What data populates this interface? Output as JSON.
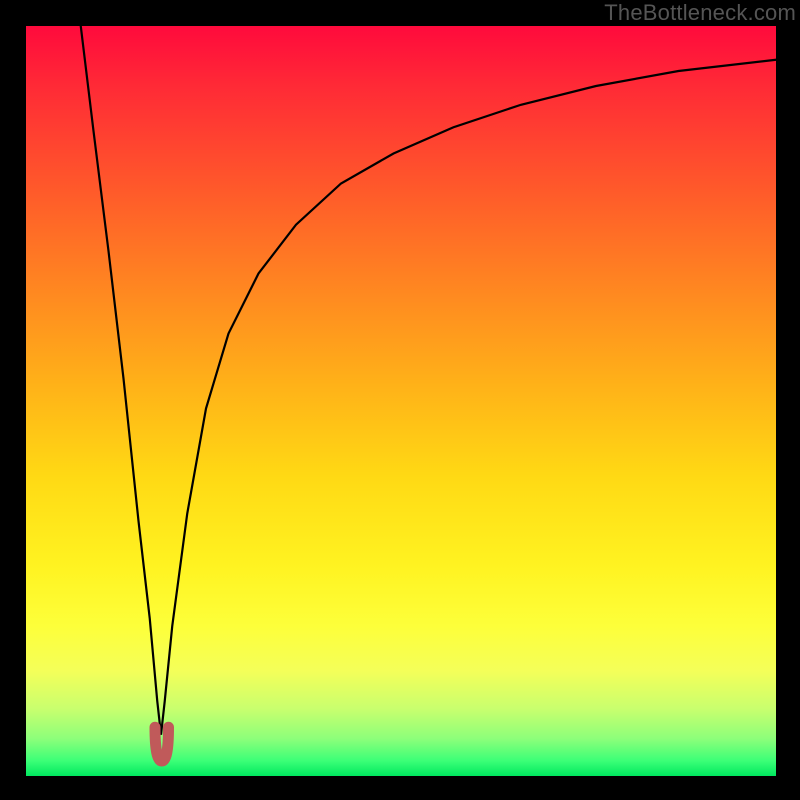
{
  "watermark": "TheBottleneck.com",
  "chart_data": {
    "type": "line",
    "title": "",
    "xlabel": "",
    "ylabel": "",
    "xlim": [
      0,
      100
    ],
    "ylim": [
      0,
      100
    ],
    "note": "No axes or tick labels are displayed. Background is a vertical red→yellow→green gradient (high→low). Curve shows a single sharp minimum near x≈18.",
    "series": [
      {
        "name": "curve",
        "color": "#000000",
        "x": [
          7.3,
          9,
          11,
          13,
          15,
          16.5,
          17.5,
          18.0,
          18.5,
          19.5,
          21.5,
          24,
          27,
          31,
          36,
          42,
          49,
          57,
          66,
          76,
          87,
          100
        ],
        "values": [
          100,
          86,
          70,
          53,
          34,
          21,
          10,
          5.5,
          10,
          20,
          35,
          49,
          59,
          67,
          73.5,
          79,
          83,
          86.5,
          89.5,
          92,
          94,
          95.5
        ]
      }
    ],
    "annotations": [
      {
        "name": "min-marker",
        "shape": "u-notch",
        "color": "#c05a5a",
        "x_range": [
          17.2,
          19.0
        ],
        "y_range": [
          2.0,
          6.5
        ]
      }
    ],
    "gradient_stops": [
      {
        "pos": 0.0,
        "color": "#ff0a3c"
      },
      {
        "pos": 0.08,
        "color": "#ff2a36"
      },
      {
        "pos": 0.22,
        "color": "#ff5a2a"
      },
      {
        "pos": 0.36,
        "color": "#ff8a20"
      },
      {
        "pos": 0.48,
        "color": "#ffb218"
      },
      {
        "pos": 0.6,
        "color": "#ffd914"
      },
      {
        "pos": 0.72,
        "color": "#fff321"
      },
      {
        "pos": 0.8,
        "color": "#fdff3a"
      },
      {
        "pos": 0.86,
        "color": "#f4ff59"
      },
      {
        "pos": 0.91,
        "color": "#c9ff6e"
      },
      {
        "pos": 0.95,
        "color": "#8dff7a"
      },
      {
        "pos": 0.98,
        "color": "#3bff77"
      },
      {
        "pos": 1.0,
        "color": "#00e85f"
      }
    ]
  }
}
